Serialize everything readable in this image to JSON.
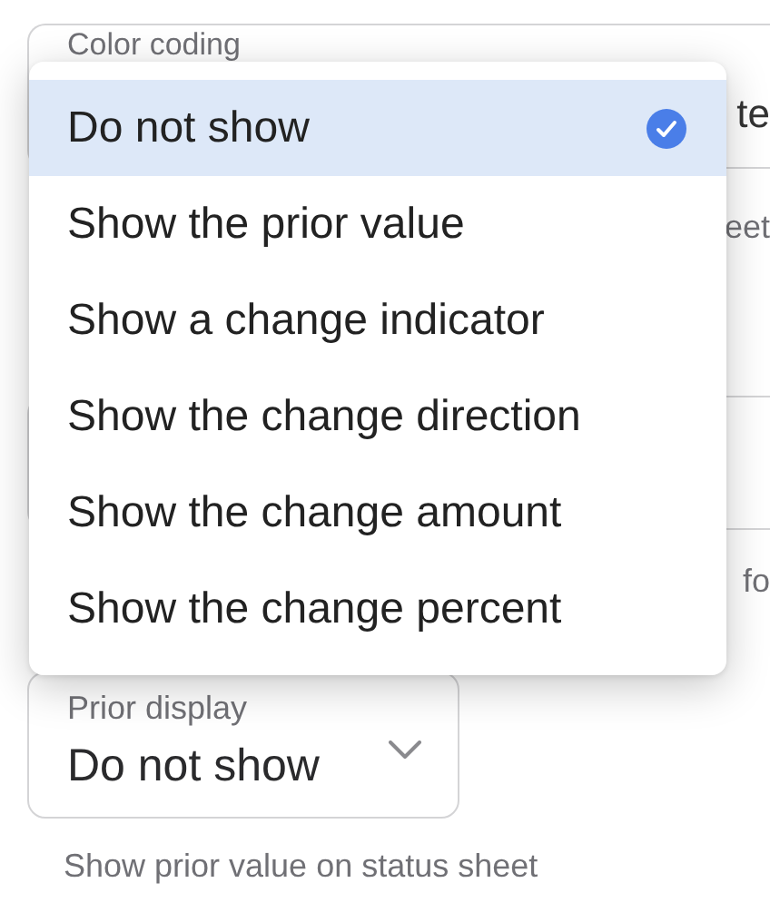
{
  "color_coding": {
    "label": "Color coding",
    "value_fragment": "te"
  },
  "partial_texts": [
    "eet",
    "fo"
  ],
  "prior_display": {
    "label": "Prior display",
    "value": "Do not show",
    "helper": "Show prior value on status sheet"
  },
  "menu": {
    "options": [
      {
        "label": "Do not show",
        "selected": true
      },
      {
        "label": "Show the prior value",
        "selected": false
      },
      {
        "label": "Show a change indicator",
        "selected": false
      },
      {
        "label": "Show the change direction",
        "selected": false
      },
      {
        "label": "Show the change amount",
        "selected": false
      },
      {
        "label": "Show the change percent",
        "selected": false
      }
    ]
  }
}
